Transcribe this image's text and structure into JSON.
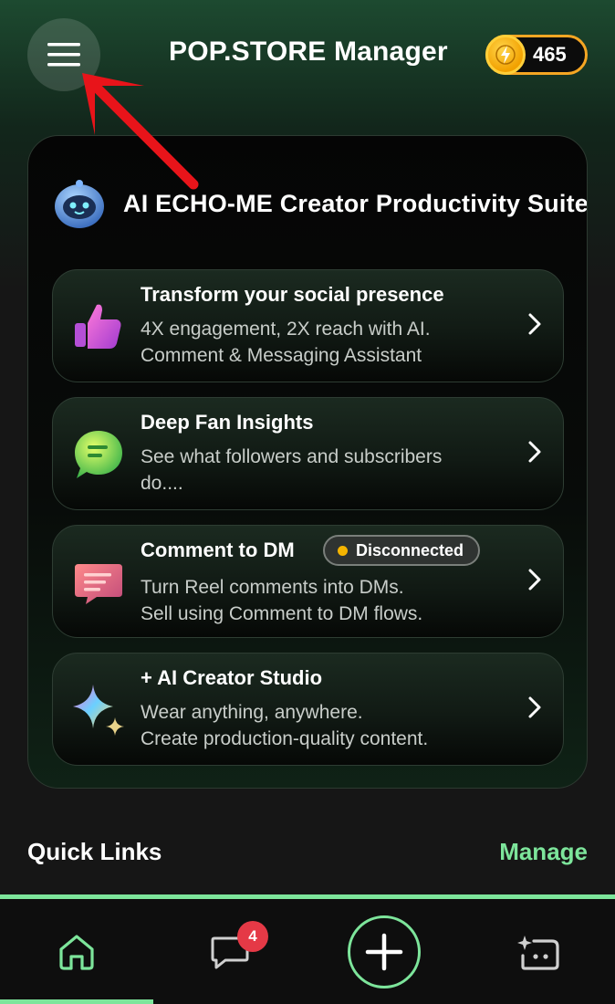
{
  "header": {
    "title": "POP.STORE Manager",
    "coins": "465",
    "menu_icon": "hamburger-menu-icon",
    "coin_icon": "lightning-coin-icon"
  },
  "suite": {
    "title": "AI ECHO-ME Creator Productivity Suite",
    "icon": "robot-icon",
    "features": [
      {
        "title": "Transform your social presence",
        "lines": [
          "4X engagement, 2X reach with AI.",
          "Comment & Messaging Assistant"
        ],
        "icon": "thumbs-up-icon"
      },
      {
        "title": "Deep Fan Insights",
        "lines": [
          "See what followers and subscribers",
          "do...."
        ],
        "icon": "chat-bubble-icon"
      },
      {
        "title": "Comment to DM",
        "badge": "Disconnected",
        "lines": [
          "Turn Reel comments into DMs.",
          "Sell using Comment to DM flows."
        ],
        "icon": "message-icon"
      },
      {
        "title": "+ AI Creator Studio",
        "lines": [
          "Wear anything, anywhere.",
          "Create production-quality content."
        ],
        "icon": "sparkle-icon"
      }
    ]
  },
  "quick_links": {
    "title": "Quick Links",
    "manage": "Manage"
  },
  "bottom_nav": {
    "message_badge": "4",
    "items": [
      "home-icon",
      "messages-icon",
      "add-icon",
      "ai-assistant-icon"
    ]
  },
  "colors": {
    "accent": "#7de59b",
    "coin": "#f5a623",
    "badge_dot": "#f5b400",
    "notification": "#e53946"
  }
}
